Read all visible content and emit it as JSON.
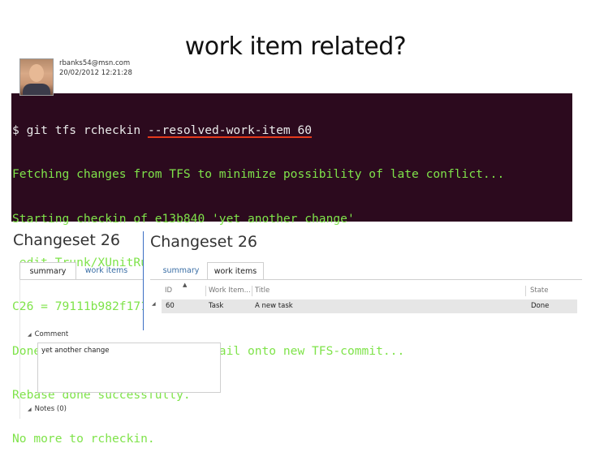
{
  "slide": {
    "title": "work item related?"
  },
  "terminal": {
    "prompt": "$ git tfs rcheckin ",
    "flag": "--resolved-work-item 60",
    "lines": [
      "Fetching changes from TFS to minimize possibility of late conflict...",
      "Starting checkin of e13b840 'yet another change'",
      " edit Trunk/XUnitRunner/ClassLibrary1/ClassLibrary1/Class1.cs",
      "C26 = 79111b982f171b6ac12ed6fdab332f2e8460fcf2",
      "Done with e13b840, rebasing tail onto new TFS-commit...",
      "Rebase done successfully.",
      "No more to rcheckin."
    ]
  },
  "left_panel": {
    "title": "Changeset 26",
    "tabs": [
      {
        "label": "summary"
      },
      {
        "label": "work items"
      }
    ],
    "author": "rbanks54@msn.com",
    "date": "20/02/2012 12:21:28",
    "comment_label": "Comment",
    "comment": "yet another change",
    "notes_label": "Notes (0)"
  },
  "right_panel": {
    "title": "Changeset 26",
    "tabs": [
      {
        "label": "summary"
      },
      {
        "label": "work items"
      }
    ],
    "columns": [
      "ID",
      "Work Item...",
      "Title",
      "State"
    ],
    "rows": [
      {
        "id": "60",
        "type": "Task",
        "title": "A new task",
        "state": "Done"
      }
    ]
  }
}
